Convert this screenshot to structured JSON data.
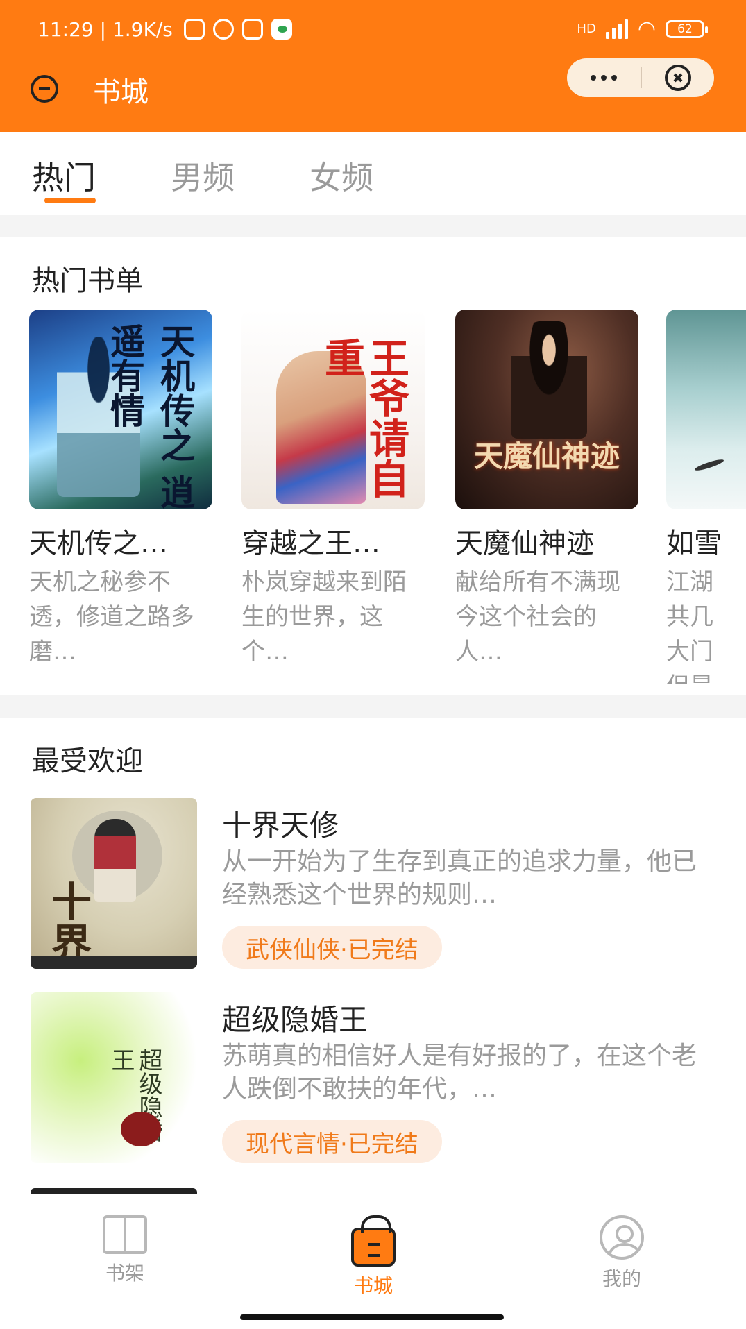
{
  "status_bar": {
    "time": "11:29",
    "speed": "1.9K/s",
    "network_label": "HD",
    "battery": "62"
  },
  "header": {
    "title": "书城",
    "colors": {
      "accent": "#ff7b12"
    }
  },
  "tabs": [
    {
      "label": "热门",
      "active": true
    },
    {
      "label": "男频",
      "active": false
    },
    {
      "label": "女频",
      "active": false
    }
  ],
  "hot_lists": {
    "title": "热门书单",
    "cards": [
      {
        "title": "天机传之…",
        "desc": "天机之秘参不透，修道之路多磨…",
        "cover_text": "天机传之 逍遥有情"
      },
      {
        "title": "穿越之王…",
        "desc": "朴岚穿越来到陌生的世界，这个…",
        "cover_text": "王爷请自重"
      },
      {
        "title": "天魔仙神迹",
        "desc": "献给所有不满现今这个社会的人…",
        "cover_text": "天魔仙神迹"
      },
      {
        "title": "如雪",
        "desc": "江湖共几大门但是真"
      }
    ]
  },
  "popular": {
    "title": "最受欢迎",
    "items": [
      {
        "title": "十界天修",
        "desc": "从一开始为了生存到真正的追求力量，他已经熟悉这个世界的规则…",
        "tag": "武侠仙侠·已完结",
        "cover_text": "十界天修"
      },
      {
        "title": "超级隐婚王",
        "desc": "苏萌真的相信好人是有好报的了，在这个老人跌倒不敢扶的年代，…",
        "tag": "现代言情·已完结",
        "cover_text": "超级隐婚王"
      }
    ]
  },
  "tabbar": [
    {
      "label": "书架",
      "icon": "bookshelf-icon",
      "active": false
    },
    {
      "label": "书城",
      "icon": "store-bag-icon",
      "active": true
    },
    {
      "label": "我的",
      "icon": "user-icon",
      "active": false
    }
  ]
}
